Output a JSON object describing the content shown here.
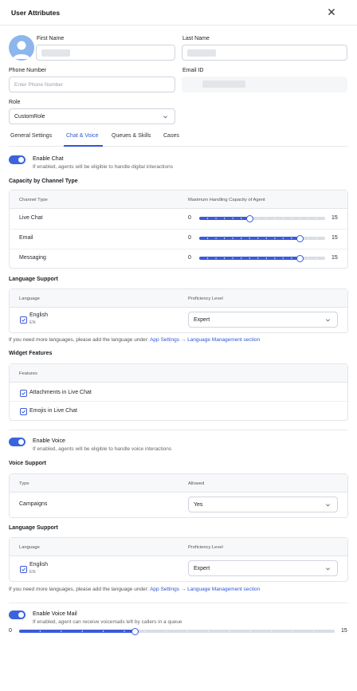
{
  "header": {
    "title": "User Attributes"
  },
  "form": {
    "first_name_label": "First Name",
    "last_name_label": "Last Name",
    "phone_label": "Phone Number",
    "phone_placeholder": "Enter Phone Number",
    "email_label": "Email ID",
    "role_label": "Role",
    "role_value": "CustomRole"
  },
  "tabs": [
    {
      "label": "General Settings"
    },
    {
      "label": "Chat & Voice"
    },
    {
      "label": "Queues & Skills"
    },
    {
      "label": "Cases"
    }
  ],
  "chat": {
    "toggle_title": "Enable Chat",
    "toggle_sub": "If enabled, agents will be eligible to handle digital interactions",
    "capacity_title": "Capacity by Channel Type",
    "col_channel": "Channel Type",
    "col_capacity": "Maximum Handling Capacity of Agent",
    "rows": [
      {
        "name": "Live Chat",
        "min": "0",
        "max": "15",
        "value": 6
      },
      {
        "name": "Email",
        "min": "0",
        "max": "15",
        "value": 12
      },
      {
        "name": "Messaging",
        "min": "0",
        "max": "15",
        "value": 12
      }
    ],
    "lang_title": "Language Support",
    "col_language": "Language",
    "col_proficiency": "Proficiency Level",
    "lang_name": "English",
    "lang_code": "EN",
    "proficiency": "Expert",
    "note_text": "If you need more languages, please add the language under: ",
    "note_link": "App Settings → Language Management section",
    "widget_title": "Widget Features",
    "col_features": "Features",
    "feature_1": "Attachments in Live Chat",
    "feature_2": "Emojis in Live Chat"
  },
  "voice": {
    "toggle_title": "Enable Voice",
    "toggle_sub": "If enabled, agents will be eligible to handle voice interactions",
    "support_title": "Voice Support",
    "col_type": "Type",
    "col_allowed": "Allowed",
    "campaigns": "Campaigns",
    "campaigns_value": "Yes",
    "lang_title": "Language Support",
    "col_language": "Language",
    "col_proficiency": "Proficiency Level",
    "lang_name": "English",
    "lang_code": "EN",
    "proficiency": "Expert",
    "note_text": "If you need more languages, please add the language under: ",
    "note_link": "App Settings → Language Management section"
  },
  "voicemail": {
    "toggle_title": "Enable Voice Mail",
    "toggle_sub": "If enabled, agent can receive voicemails left by callers in a queue",
    "min": "0",
    "max": "15",
    "value": 5.5
  },
  "colors": {
    "accent": "#3b5bdb",
    "link": "#2f57d6",
    "avatar": "#8cb6ec"
  }
}
